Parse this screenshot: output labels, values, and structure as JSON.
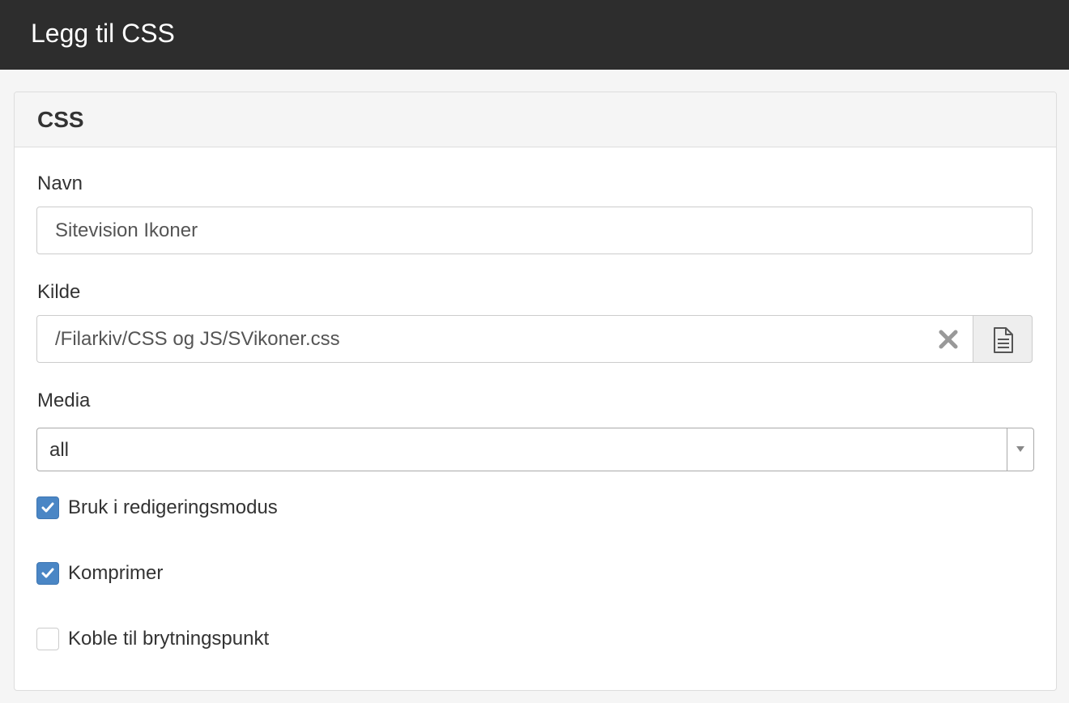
{
  "header": {
    "title": "Legg til CSS"
  },
  "panel": {
    "title": "CSS"
  },
  "fields": {
    "name": {
      "label": "Navn",
      "value": "Sitevision Ikoner"
    },
    "source": {
      "label": "Kilde",
      "value": "/Filarkiv/CSS og JS/SVikoner.css",
      "clear_icon": "close-icon",
      "browse_icon": "document-icon"
    },
    "media": {
      "label": "Media",
      "selected": "all"
    }
  },
  "options": [
    {
      "label": "Bruk i redigeringsmodus",
      "checked": true
    },
    {
      "label": "Komprimer",
      "checked": true
    },
    {
      "label": "Koble til brytningspunkt",
      "checked": false
    }
  ],
  "colors": {
    "header_bg": "#2d2d2d",
    "checkbox_accent": "#4a86c5"
  }
}
